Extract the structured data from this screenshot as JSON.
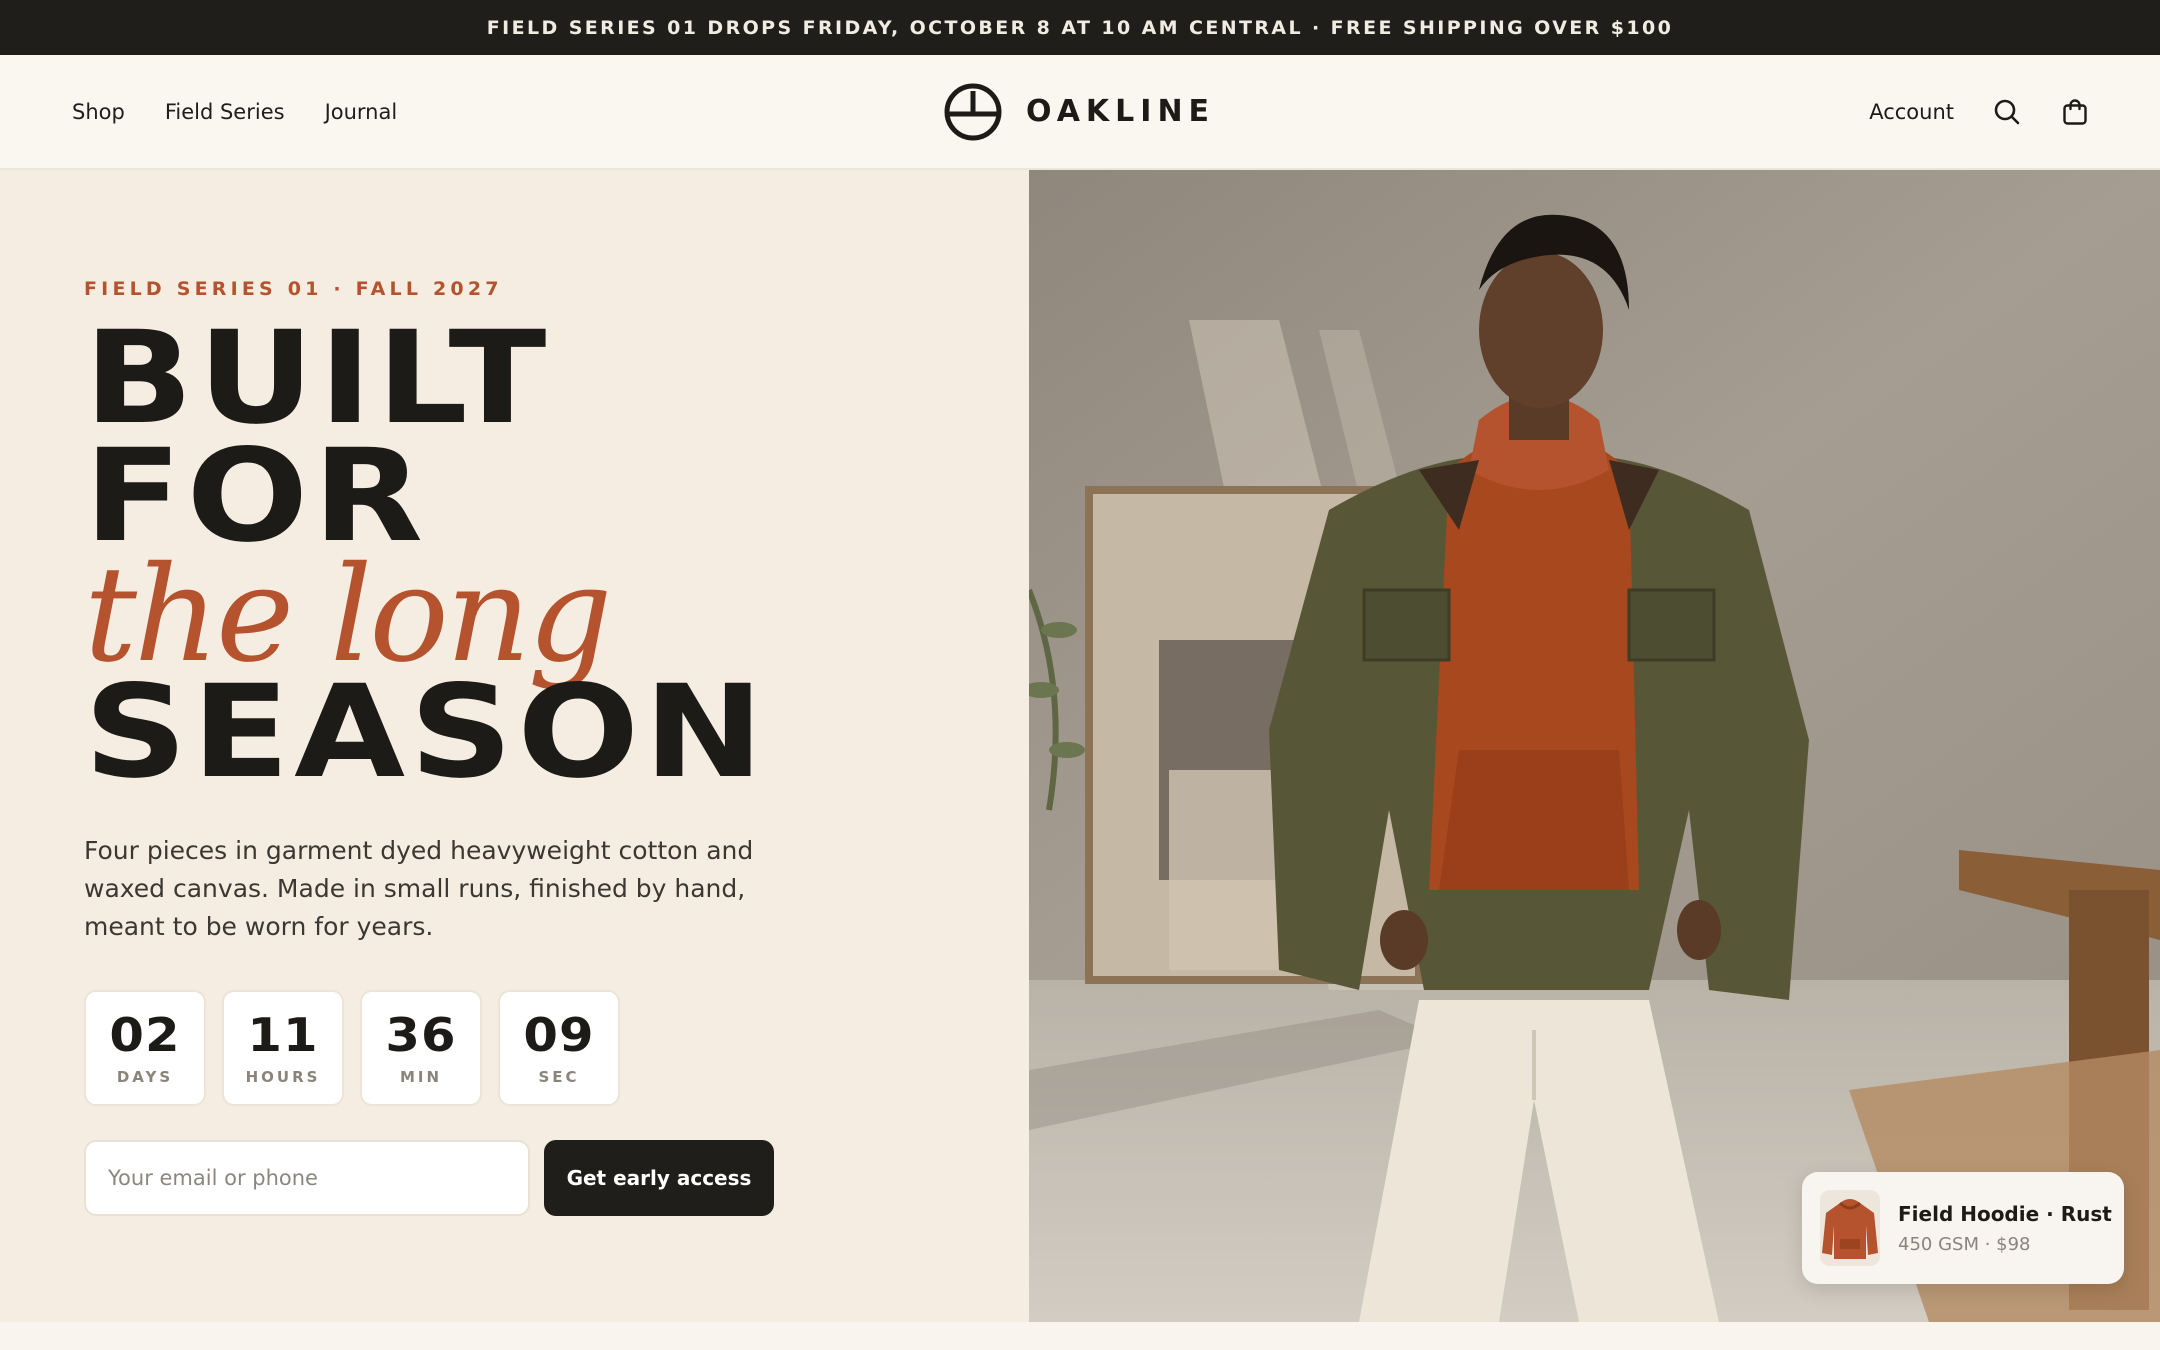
{
  "announcement": {
    "text": "FIELD SERIES 01 DROPS FRIDAY, OCTOBER 8 AT 10 AM CENTRAL · FREE SHIPPING OVER $100"
  },
  "nav": {
    "links": [
      "Shop",
      "Field Series",
      "Journal"
    ],
    "brand": "OAKLINE",
    "account": "Account",
    "icons": [
      "search-icon",
      "bag-icon"
    ]
  },
  "hero": {
    "eyebrow": "FIELD SERIES 01 · FALL 2027",
    "headline": {
      "line1": "BUILT",
      "line2": "FOR",
      "line3": "the long",
      "line4": "SEASON"
    },
    "description": "Four pieces in garment dyed heavyweight cotton and waxed canvas. Made in small runs, finished by hand, meant to be worn for years.",
    "countdown": [
      {
        "value": "02",
        "label": "DAYS"
      },
      {
        "value": "11",
        "label": "HOURS"
      },
      {
        "value": "36",
        "label": "MIN"
      },
      {
        "value": "09",
        "label": "SEC"
      }
    ],
    "email_placeholder": "Your email or phone",
    "email_value": "",
    "cta_label": "Get early access"
  },
  "product_card": {
    "name": "Field Hoodie · Rust",
    "meta": "450 GSM · $98"
  },
  "colors": {
    "accent": "#b4532d",
    "dark": "#1f1e1b",
    "hero_bg": "#f5ede1",
    "nav_bg": "#faf7f0"
  }
}
